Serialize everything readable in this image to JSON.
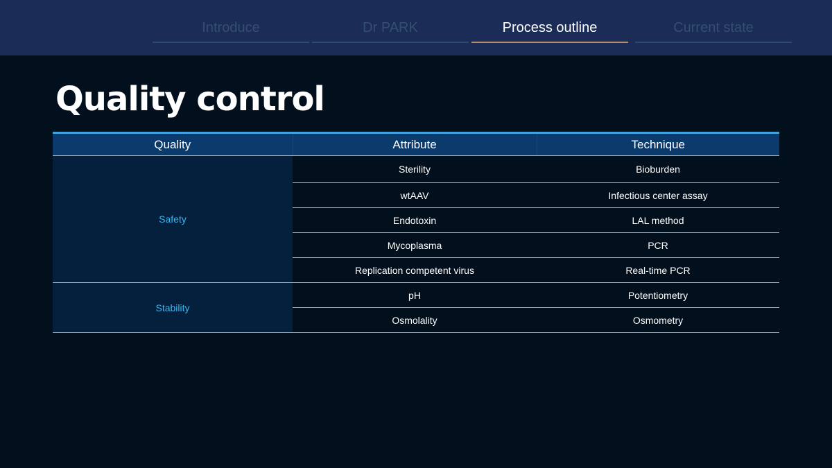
{
  "nav": {
    "tabs": [
      {
        "label": "Introduce",
        "active": false
      },
      {
        "label": "Dr PARK",
        "active": false
      },
      {
        "label": "Process outline",
        "active": true
      },
      {
        "label": "Current state",
        "active": false
      }
    ]
  },
  "page": {
    "title": "Quality control"
  },
  "table": {
    "headers": [
      "Quality",
      "Attribute",
      "Technique"
    ],
    "groups": [
      {
        "label": "Safety",
        "rows": [
          {
            "attribute": "Sterility",
            "technique": "Bioburden"
          },
          {
            "attribute": "wtAAV",
            "technique": "Infectious center assay"
          },
          {
            "attribute": "Endotoxin",
            "technique": "LAL method"
          },
          {
            "attribute": "Mycoplasma",
            "technique": "PCR"
          },
          {
            "attribute": "Replication competent virus",
            "technique": "Real-time PCR"
          }
        ]
      },
      {
        "label": "Stability",
        "rows": [
          {
            "attribute": "pH",
            "technique": "Potentiometry"
          },
          {
            "attribute": "Osmolality",
            "technique": "Osmometry"
          }
        ]
      }
    ]
  },
  "colors": {
    "topbar": "#1b2c56",
    "background": "#020f1c",
    "header_bg": "#0b3a6c",
    "group_bg": "#04203c",
    "group_text": "#38b6f0",
    "active_underline": "#b58f6e",
    "table_top_border": "#3fa3df"
  }
}
